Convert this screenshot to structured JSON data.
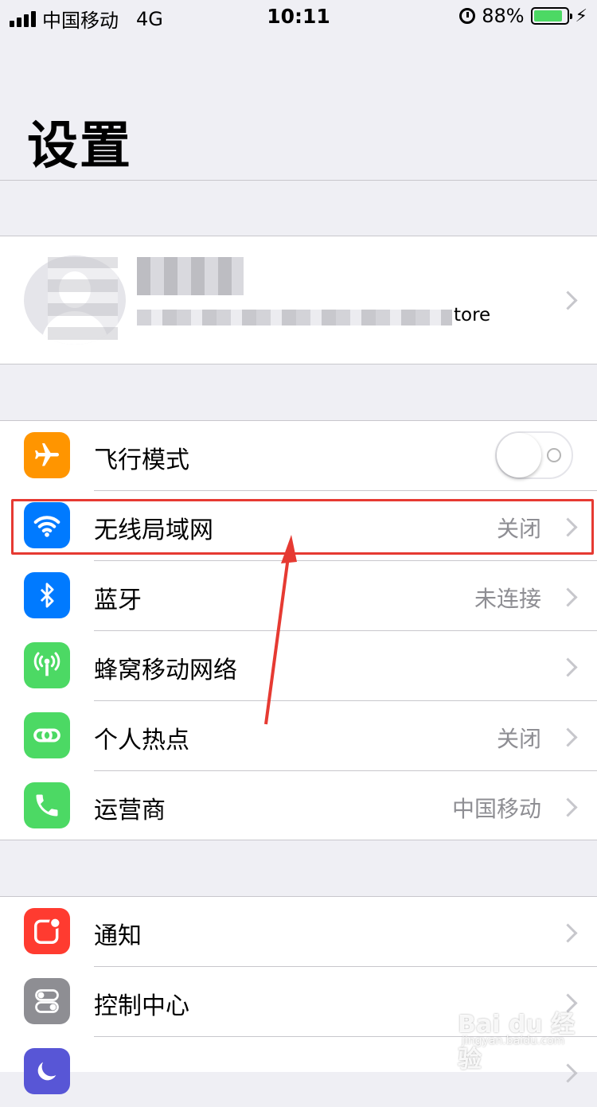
{
  "status_bar": {
    "carrier": "中国移动",
    "network": "4G",
    "time": "10:11",
    "battery_percent": "88%",
    "battery_level": 0.88
  },
  "page": {
    "title": "设置"
  },
  "profile": {
    "subtitle_visible": "tore"
  },
  "network_section": {
    "rows": [
      {
        "label": "飞行模式",
        "icon": "airplane-icon",
        "color": "#ff9500",
        "toggle": false
      },
      {
        "label": "无线局域网",
        "value": "关闭",
        "icon": "wifi-icon",
        "color": "#007aff"
      },
      {
        "label": "蓝牙",
        "value": "未连接",
        "icon": "bluetooth-icon",
        "color": "#007aff"
      },
      {
        "label": "蜂窝移动网络",
        "value": "",
        "icon": "cellular-icon",
        "color": "#4cd964"
      },
      {
        "label": "个人热点",
        "value": "关闭",
        "icon": "hotspot-icon",
        "color": "#4cd964"
      },
      {
        "label": "运营商",
        "value": "中国移动",
        "icon": "phone-icon",
        "color": "#4cd964"
      }
    ]
  },
  "system_section": {
    "rows": [
      {
        "label": "通知",
        "icon": "notification-icon",
        "color": "#ff3b30"
      },
      {
        "label": "控制中心",
        "icon": "control-center-icon",
        "color": "#8e8e93"
      },
      {
        "icon": "moon-icon",
        "color": "#5856d6"
      }
    ]
  },
  "watermark": {
    "brand": "Bai du 经验",
    "url": "jingyan.baidu.com"
  },
  "colors": {
    "highlight": "#e63a32",
    "background": "#efeff4"
  }
}
